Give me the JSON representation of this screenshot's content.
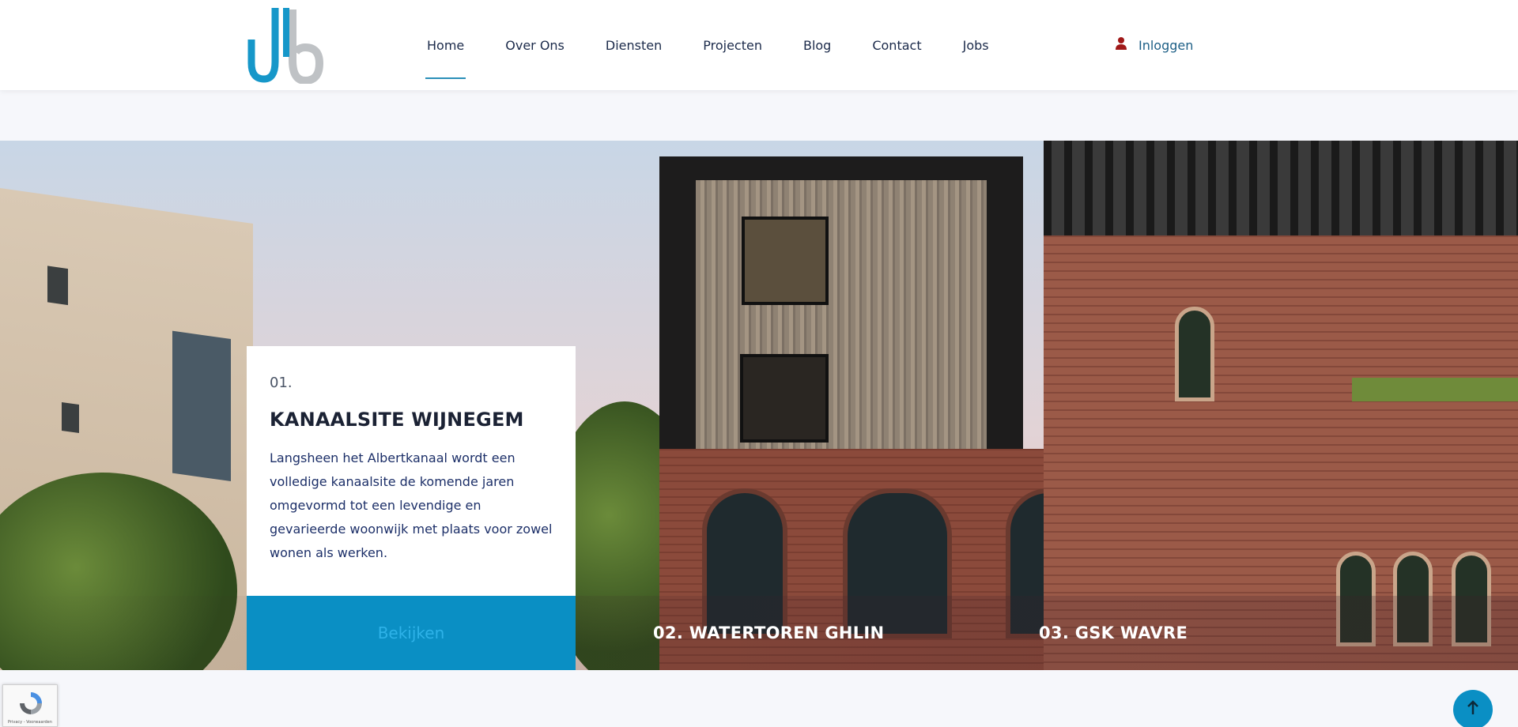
{
  "header": {
    "nav": [
      {
        "label": "Home",
        "active": true
      },
      {
        "label": "Over Ons"
      },
      {
        "label": "Diensten"
      },
      {
        "label": "Projecten"
      },
      {
        "label": "Blog"
      },
      {
        "label": "Contact"
      },
      {
        "label": "Jobs"
      }
    ],
    "login_label": "Inloggen",
    "login_icon": "user-icon"
  },
  "hero": {
    "active_slide": {
      "number": "01.",
      "title": "KANAALSITE WIJNEGEM",
      "description": "Langsheen het Albertkanaal wordt een volledige kanaalsite de komende jaren omgevormd tot een levendige en gevarieerde woonwijk met plaats voor zowel wonen als werken.",
      "button_label": "Bekijken"
    },
    "other_slides": [
      {
        "label": "02. WATERTOREN GHLIN"
      },
      {
        "label": "03. GSK WAVRE"
      }
    ]
  },
  "widgets": {
    "recaptcha_text": "Privacy - Voorwaarden",
    "back_to_top_icon": "arrow-up-icon"
  },
  "colors": {
    "accent": "#0a8fc4",
    "nav_text": "#1b2a4a",
    "login_text": "#1d5f86",
    "user_icon": "#a01818"
  }
}
